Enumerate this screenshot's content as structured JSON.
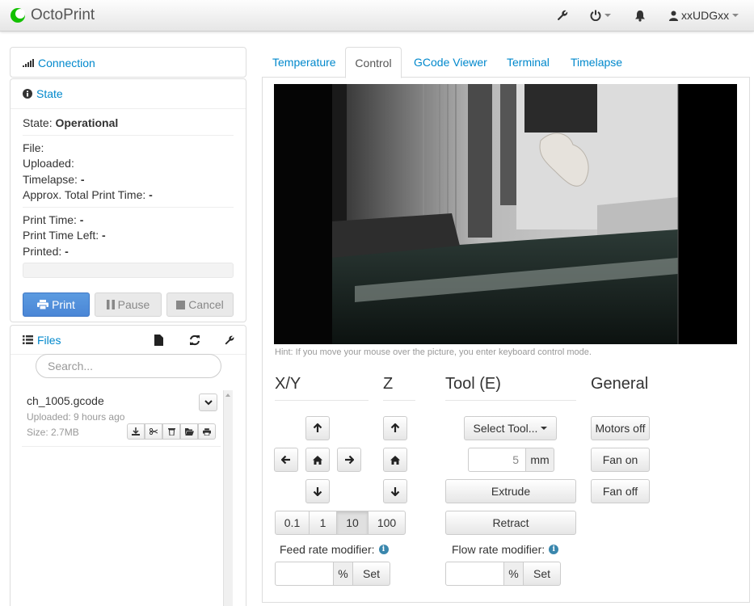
{
  "navbar": {
    "brand": "OctoPrint",
    "user": "xxUDGxx"
  },
  "sidebar": {
    "connection": {
      "title": "Connection"
    },
    "state": {
      "title": "State",
      "state_label": "State:",
      "state_value": "Operational",
      "file_label": "File:",
      "uploaded_label": "Uploaded:",
      "timelapse_label": "Timelapse:",
      "timelapse_value": "-",
      "approx_label": "Approx. Total Print Time:",
      "approx_value": "-",
      "print_time_label": "Print Time:",
      "print_time_value": "-",
      "print_time_left_label": "Print Time Left:",
      "print_time_left_value": "-",
      "printed_label": "Printed:",
      "printed_value": "-",
      "progress_fraction": 0,
      "buttons": {
        "print": "Print",
        "pause": "Pause",
        "cancel": "Cancel"
      }
    },
    "files": {
      "title": "Files",
      "search_placeholder": "Search...",
      "items": [
        {
          "name": "ch_1005.gcode",
          "uploaded": "Uploaded: 9 hours ago",
          "size": "Size: 2.7MB"
        }
      ]
    }
  },
  "tabs": [
    {
      "label": "Temperature",
      "active": false
    },
    {
      "label": "Control",
      "active": true
    },
    {
      "label": "GCode Viewer",
      "active": false
    },
    {
      "label": "Terminal",
      "active": false
    },
    {
      "label": "Timelapse",
      "active": false
    }
  ],
  "control": {
    "hint": "Hint: If you move your mouse over the picture, you enter keyboard control mode.",
    "sections": {
      "xy": "X/Y",
      "z": "Z",
      "tool": "Tool (E)",
      "general": "General"
    },
    "steps": [
      "0.1",
      "1",
      "10",
      "100"
    ],
    "active_step": "10",
    "select_tool": "Select Tool...",
    "extrude_amount": "5",
    "extrude_unit": "mm",
    "extrude": "Extrude",
    "retract": "Retract",
    "general_buttons": [
      "Motors off",
      "Fan on",
      "Fan off"
    ],
    "feed_rate_label": "Feed rate modifier:",
    "flow_rate_label": "Flow rate modifier:",
    "percent": "%",
    "set": "Set"
  }
}
